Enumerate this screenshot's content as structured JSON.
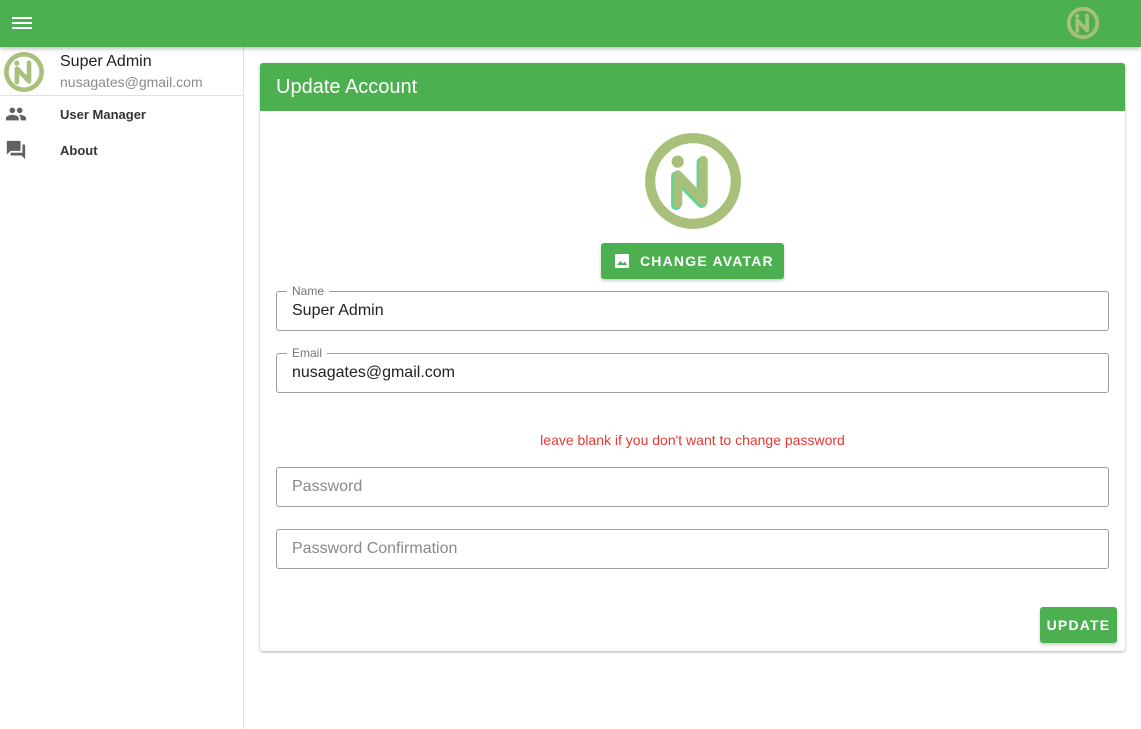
{
  "colors": {
    "primary": "#4caf50",
    "error": "#e53935",
    "logo": "#a8c07a"
  },
  "appbar": {
    "menu_icon": "menu-icon",
    "logo_icon": "n-logo-icon"
  },
  "sidebar": {
    "profile": {
      "name": "Super Admin",
      "email": "nusagates@gmail.com"
    },
    "items": [
      {
        "label": "User Manager",
        "icon": "people-icon"
      },
      {
        "label": "About",
        "icon": "forum-icon"
      }
    ]
  },
  "card": {
    "title": "Update Account",
    "change_avatar_label": "CHANGE AVATAR",
    "fields": {
      "name": {
        "label": "Name",
        "value": "Super Admin"
      },
      "email": {
        "label": "Email",
        "value": "nusagates@gmail.com"
      },
      "password": {
        "placeholder": "Password"
      },
      "password_confirmation": {
        "placeholder": "Password Confirmation"
      }
    },
    "password_hint": "leave blank if you don't want to change password",
    "update_label": "UPDATE"
  }
}
